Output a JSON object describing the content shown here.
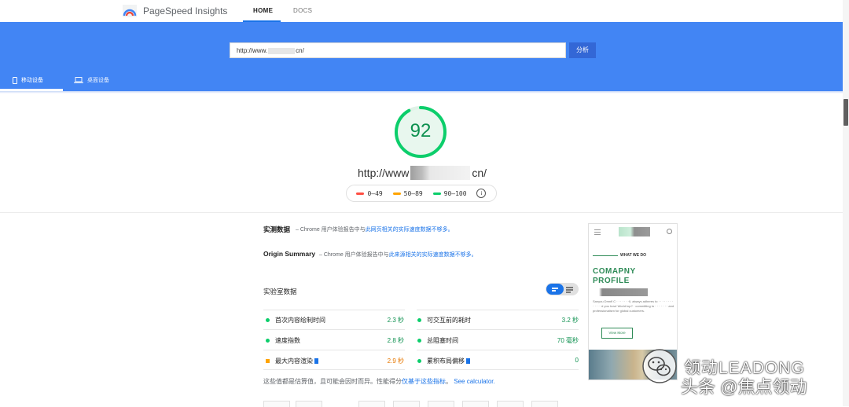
{
  "topnav": {
    "app_title": "PageSpeed Insights",
    "tabs": [
      {
        "label": "HOME",
        "active": true
      },
      {
        "label": "DOCS",
        "active": false
      }
    ]
  },
  "search": {
    "url_prefix": "http://www.",
    "url_suffix": "cn/",
    "button_label": "分析"
  },
  "device_tabs": [
    {
      "label": "移动设备",
      "active": true,
      "icon": "smartphone-icon"
    },
    {
      "label": "桌面设备",
      "active": false,
      "icon": "laptop-icon"
    }
  ],
  "score": {
    "value": "92",
    "fraction": 0.92,
    "color": "#0cce6b",
    "tested_url_prefix": "http://www",
    "tested_url_suffix": "cn/"
  },
  "legend": [
    {
      "label": "0–49",
      "color": "#ff4e42"
    },
    {
      "label": "50–89",
      "color": "#ffa400"
    },
    {
      "label": "90–100",
      "color": "#0cce6b"
    }
  ],
  "field_data": {
    "title": "实测数据",
    "desc_prefix": " – Chrome 用户体验报告中与",
    "desc_link": "此网页相关的实际速度数据不够多。"
  },
  "origin_summary": {
    "title": "Origin Summary",
    "desc_prefix": " – Chrome 用户体验报告中与",
    "desc_link": "此来源相关的实际速度数据不够多。"
  },
  "lab_data": {
    "title": "实验室数据",
    "metrics": [
      {
        "label": "首次内容绘制时间",
        "value": "2.3 秒",
        "status": "green"
      },
      {
        "label": "可交互前的耗时",
        "value": "3.2 秒",
        "status": "green"
      },
      {
        "label": "速度指数",
        "value": "2.8 秒",
        "status": "green"
      },
      {
        "label": "总阻塞时间",
        "value": "70 毫秒",
        "status": "green"
      },
      {
        "label": "最大内容渲染",
        "value": "2.9 秒",
        "status": "orange"
      },
      {
        "label": "累积布局偏移",
        "value": "0",
        "status": "green"
      }
    ],
    "footnote_prefix": "这些值都是估算值，且可能会因时而异。性能得分",
    "footnote_link1": "仅基于这些指标",
    "footnote_sep": "。",
    "footnote_link2": "See calculator."
  },
  "preview": {
    "what_we_do": "WHAT WE DO",
    "company_profile": "COMAPNY PROFILE",
    "body_text": "Sanyou Dmnfl C · · · · · · ·ll, always adheres to · · · · · · · · · · · · ·d you how! World top? · committing to · · · · · · · and professionalism for global customers.",
    "button_label": "View More"
  },
  "watermark": {
    "line1": "领动LEADONG",
    "line2": "头条 @焦点领动"
  }
}
